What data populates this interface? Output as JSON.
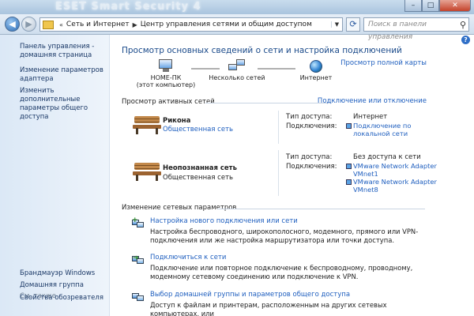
{
  "window": {
    "ghost_title": "ESET Smart Security 4",
    "min_symbol": "–",
    "max_symbol": "□",
    "close_symbol": "✕"
  },
  "nav": {
    "back_symbol": "◀",
    "forward_symbol": "▶"
  },
  "breadcrumbs": [
    "Сеть и Интернет",
    "Центр управления сетями и общим доступом"
  ],
  "search": {
    "placeholder": "Поиск в панели управления"
  },
  "sidebar": {
    "links": [
      "Панель управления - домашняя страница",
      "Изменение параметров адаптера",
      "Изменить дополнительные параметры общего доступа"
    ],
    "see_also_title": "См. также",
    "see_also": [
      "Брандмауэр Windows",
      "Домашняя группа",
      "Свойства обозревателя"
    ]
  },
  "main": {
    "heading": "Просмотр основных сведений о сети и настройка подключений",
    "map_link": "Просмотр полной карты",
    "map": {
      "pc_name": "HOME-ПК",
      "pc_sub": "(этот компьютер)",
      "multi": "Несколько сетей",
      "internet": "Интернет"
    },
    "active_title": "Просмотр активных сетей",
    "connect_link": "Подключение или отключение",
    "networks": [
      {
        "name": "Рикона",
        "type": "Общественная сеть",
        "access_label": "Тип доступа:",
        "access_value": "Интернет",
        "conn_label": "Подключения:",
        "conns": [
          "Подключение по локальной сети"
        ]
      },
      {
        "name": "Неопознанная сеть",
        "type": "Общественная сеть",
        "access_label": "Тип доступа:",
        "access_value": "Без доступа к сети",
        "conn_label": "Подключения:",
        "conns": [
          "VMware Network Adapter VMnet1",
          "VMware Network Adapter VMnet8"
        ]
      }
    ],
    "change_title": "Изменение сетевых параметров",
    "tasks": [
      {
        "link": "Настройка нового подключения или сети",
        "desc": "Настройка беспроводного, широкополосного, модемного, прямого или VPN-подключения или же настройка маршрутизатора или точки доступа."
      },
      {
        "link": "Подключиться к сети",
        "desc": "Подключение или повторное подключение к беспроводному, проводному, модемному сетевому соединению или подключение к VPN."
      },
      {
        "link": "Выбор домашней группы и параметров общего доступа",
        "desc": "Доступ к файлам и принтерам, расположенным на других сетевых компьютерах, или"
      }
    ]
  }
}
